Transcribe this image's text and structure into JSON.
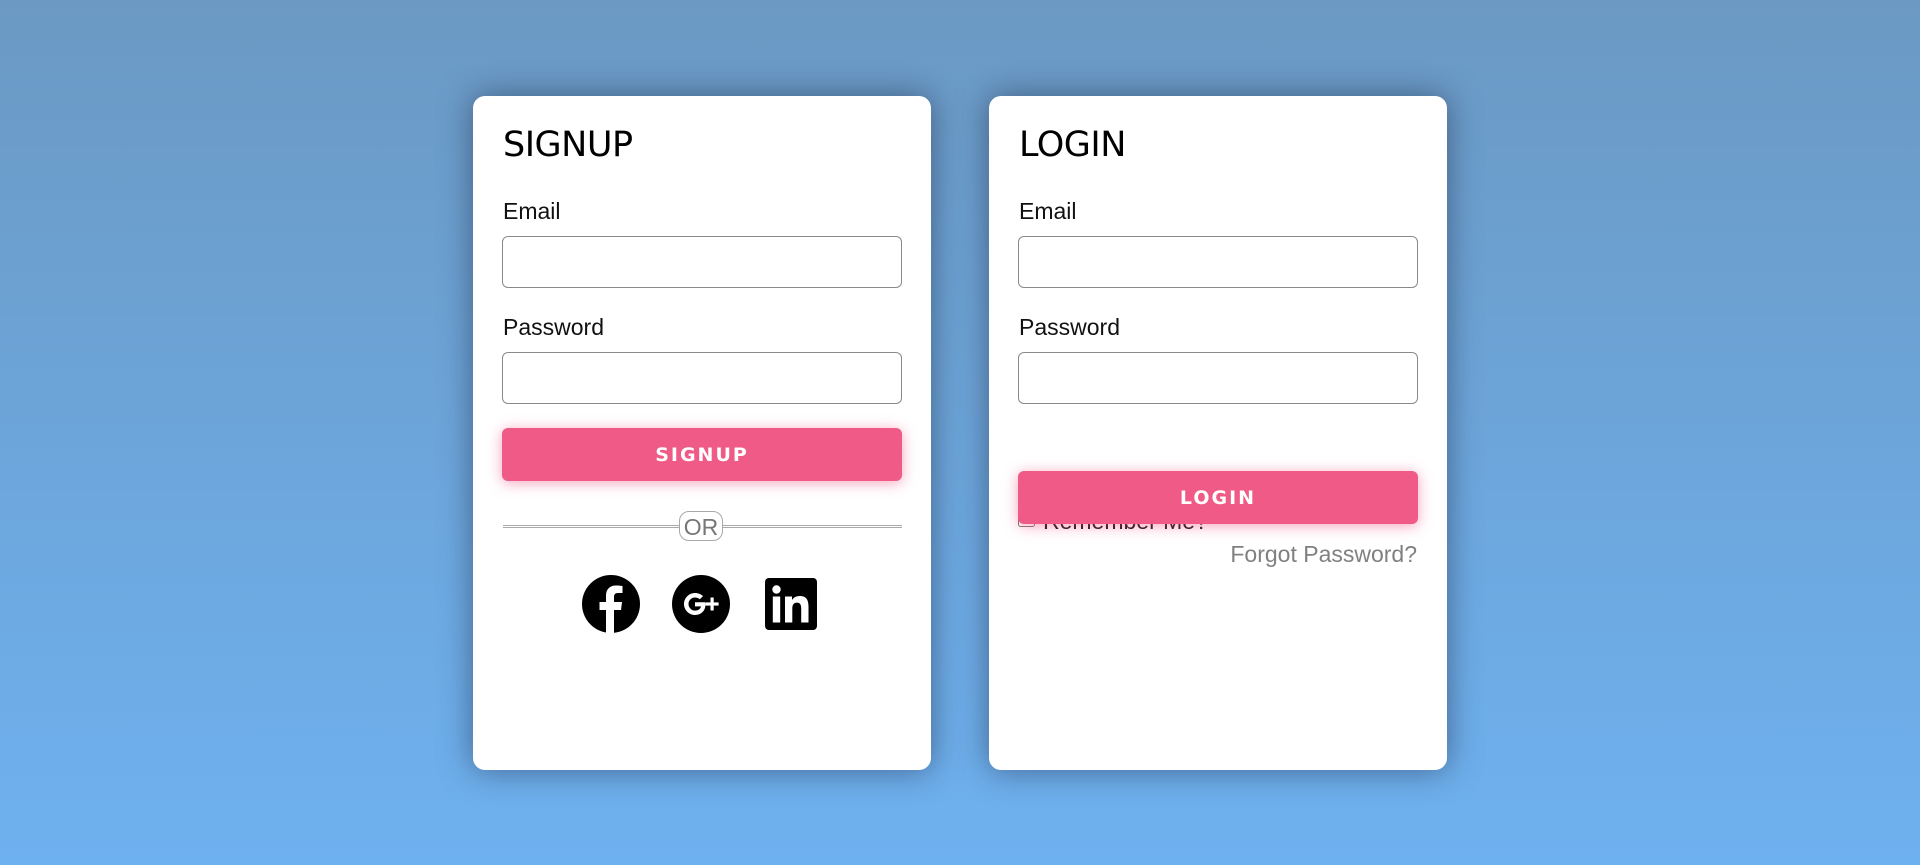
{
  "colors": {
    "background_top": "#6b99c3",
    "background_bottom": "#6eb1f0",
    "accent": "#ef5a86"
  },
  "signup": {
    "title": "SIGNUP",
    "email_label": "Email",
    "email_value": "",
    "password_label": "Password",
    "password_value": "",
    "button_label": "SIGNUP",
    "divider_text": "OR",
    "social_icons": [
      "facebook-icon",
      "google-plus-icon",
      "linkedin-icon"
    ]
  },
  "login": {
    "title": "LOGIN",
    "email_label": "Email",
    "email_value": "",
    "password_label": "Password",
    "password_value": "",
    "remember_label": "Remember Me?",
    "remember_checked": false,
    "button_label": "LOGIN",
    "forgot_label": "Forgot Password?"
  }
}
